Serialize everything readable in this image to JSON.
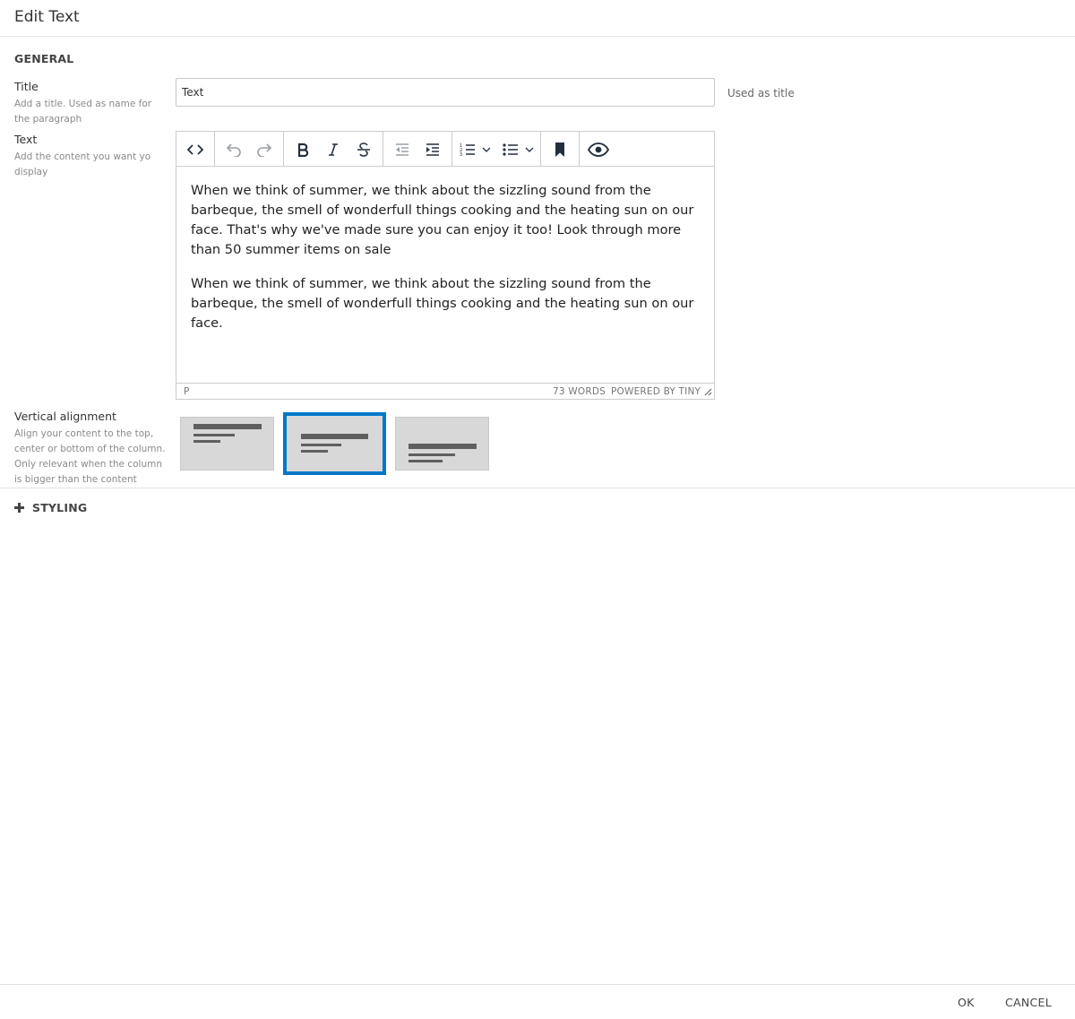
{
  "dialog": {
    "title": "Edit Text"
  },
  "general": {
    "section_title": "GENERAL",
    "title_field": {
      "label": "Title",
      "help": "Add a title. Used as name for the paragraph",
      "value": "Text",
      "hint": "Used as title"
    },
    "text_field": {
      "label": "Text",
      "help": "Add the content you want yo display"
    },
    "editor": {
      "toolbar": [
        {
          "name": "source-code",
          "icon": "code-icon"
        },
        {
          "name": "undo",
          "icon": "undo-icon"
        },
        {
          "name": "redo",
          "icon": "redo-icon"
        },
        {
          "name": "bold",
          "icon": "bold-icon"
        },
        {
          "name": "italic",
          "icon": "italic-icon"
        },
        {
          "name": "strikethrough",
          "icon": "strikethrough-icon"
        },
        {
          "name": "outdent",
          "icon": "outdent-icon"
        },
        {
          "name": "indent",
          "icon": "indent-icon"
        },
        {
          "name": "numbered-list",
          "icon": "ordered-list-icon"
        },
        {
          "name": "bullet-list",
          "icon": "unordered-list-icon"
        },
        {
          "name": "anchor",
          "icon": "bookmark-icon"
        },
        {
          "name": "preview",
          "icon": "eye-icon"
        }
      ],
      "paragraphs": [
        "When we think of summer, we think about the sizzling sound from the barbeque, the smell of wonderfull things cooking and the heating sun on our face. That's why we've made sure you can enjoy it too! Look through more than 50 summer items on sale",
        "When we think of summer, we think about the sizzling sound from the barbeque, the smell of wonderfull things cooking and the heating sun on our face."
      ],
      "status": {
        "path": "P",
        "word_count": "73 WORDS",
        "brand": "POWERED BY TINY"
      }
    },
    "vertical_alignment": {
      "label": "Vertical alignment",
      "help": "Align your content to the top, center or bottom of the column. Only relevant when the column is bigger than the content",
      "options": [
        "top",
        "center",
        "bottom"
      ],
      "selected": "center",
      "accent_color": "#0078c8"
    }
  },
  "styling": {
    "label": "STYLING",
    "icon": "plus-icon"
  },
  "footer": {
    "ok_label": "OK",
    "cancel_label": "CANCEL"
  }
}
